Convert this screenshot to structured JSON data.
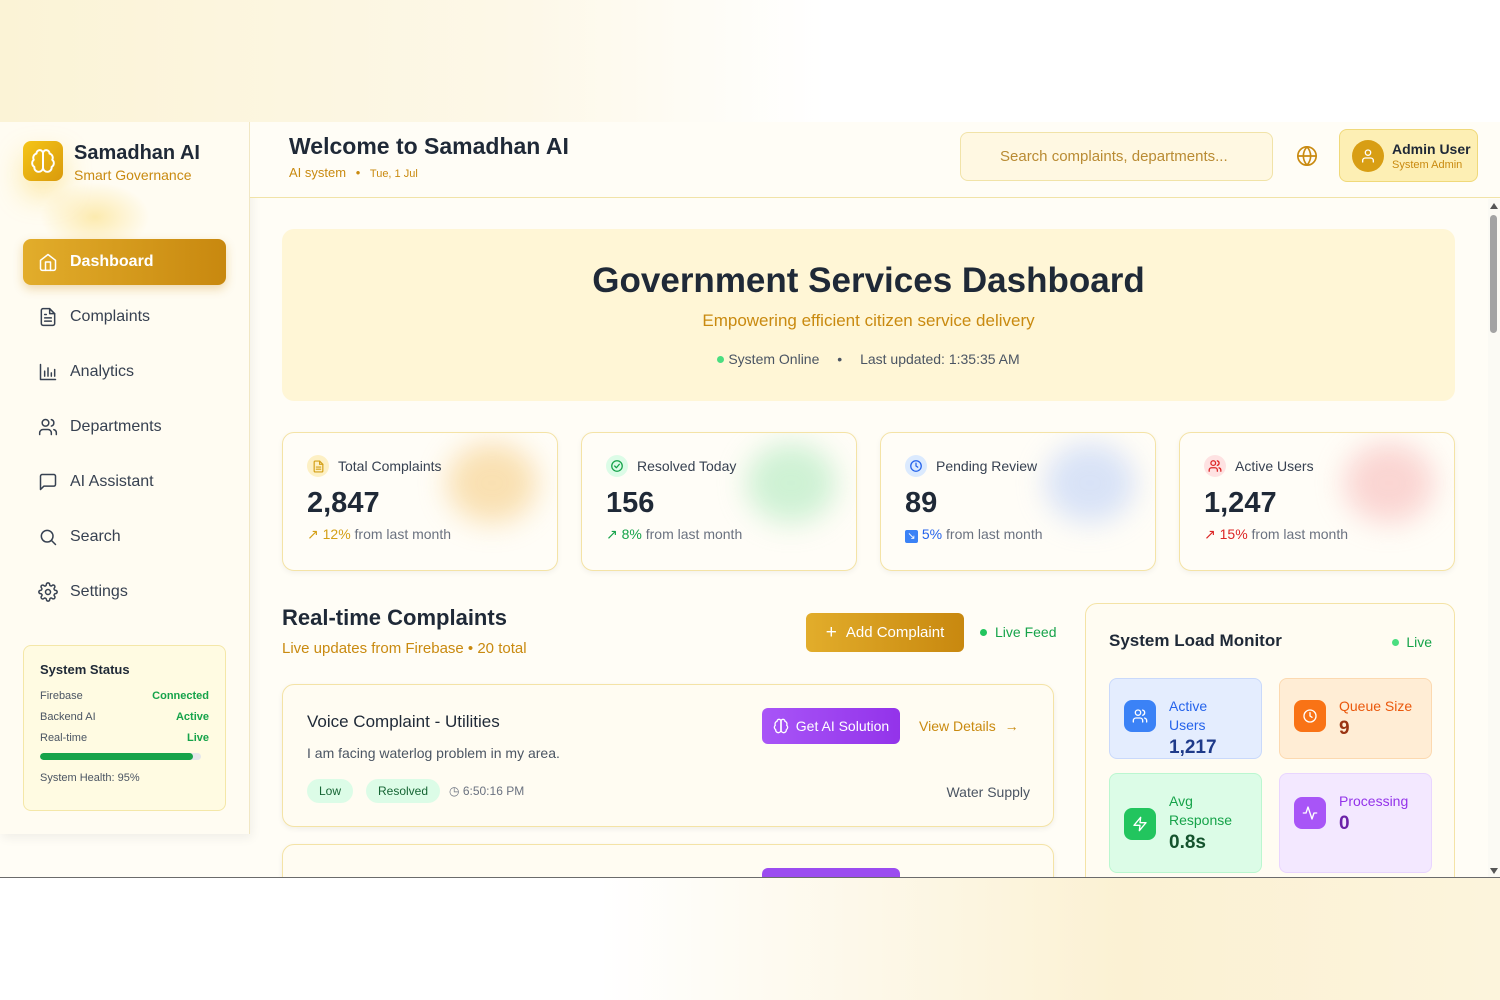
{
  "brand": {
    "name": "Samadhan AI",
    "tagline": "Smart Governance"
  },
  "sidebar": {
    "items": [
      {
        "label": "Dashboard",
        "icon": "home-icon",
        "active": true
      },
      {
        "label": "Complaints",
        "icon": "file-text-icon"
      },
      {
        "label": "Analytics",
        "icon": "bar-chart-icon"
      },
      {
        "label": "Departments",
        "icon": "users-icon"
      },
      {
        "label": "AI Assistant",
        "icon": "message-square-icon"
      },
      {
        "label": "Search",
        "icon": "search-icon"
      },
      {
        "label": "Settings",
        "icon": "gear-icon"
      }
    ],
    "status": {
      "title": "System Status",
      "rows": [
        {
          "label": "Firebase",
          "value": "Connected"
        },
        {
          "label": "Backend AI",
          "value": "Active"
        },
        {
          "label": "Real-time",
          "value": "Live"
        }
      ],
      "health_value": 0.95,
      "health_text": "System Health: 95%"
    }
  },
  "header": {
    "title": "Welcome to Samadhan AI",
    "subtitle": "AI system",
    "date": "Tue, 1 Jul",
    "search_placeholder": "Search complaints, departments...",
    "user_name": "Admin User",
    "user_role": "System Admin"
  },
  "hero": {
    "title": "Government Services Dashboard",
    "subtitle": "Empowering efficient citizen service delivery",
    "status": "System Online",
    "last_updated": "Last updated: 1:35:35 AM"
  },
  "stats": [
    {
      "label": "Total Complaints",
      "value": "2,847",
      "change": "12%",
      "suffix": "from last month",
      "color": "#d4a017"
    },
    {
      "label": "Resolved Today",
      "value": "156",
      "change": "8%",
      "suffix": "from last month",
      "color": "#16a34a"
    },
    {
      "label": "Pending Review",
      "value": "89",
      "change": "5%",
      "suffix": "from last month",
      "color": "#2563eb"
    },
    {
      "label": "Active Users",
      "value": "1,247",
      "change": "15%",
      "suffix": "from last month",
      "color": "#dc2626"
    }
  ],
  "complaints_section": {
    "title": "Real-time Complaints",
    "subtitle": "Live updates from Firebase • 20 total",
    "add_label": "Add Complaint",
    "live_label": "Live Feed"
  },
  "complaints": [
    {
      "title": "Voice Complaint - Utilities",
      "description": "I am facing waterlog problem in my area.",
      "priority": "Low",
      "status": "Resolved",
      "time": "6:50:16 PM",
      "department": "Water Supply",
      "ai_label": "Get AI Solution",
      "view_label": "View Details"
    }
  ],
  "load_monitor": {
    "title": "System Load Monitor",
    "live_label": "Live",
    "metrics": [
      {
        "label": "Active Users",
        "value": "1,217",
        "icon": "users-icon",
        "color": "#3b82f6"
      },
      {
        "label": "Queue Size",
        "value": "9",
        "icon": "clock-icon",
        "color": "#f97316"
      },
      {
        "label": "Avg Response",
        "value": "0.8s",
        "icon": "zap-icon",
        "color": "#22c55e"
      },
      {
        "label": "Processing",
        "value": "0",
        "icon": "activity-icon",
        "color": "#a855f7"
      }
    ]
  }
}
